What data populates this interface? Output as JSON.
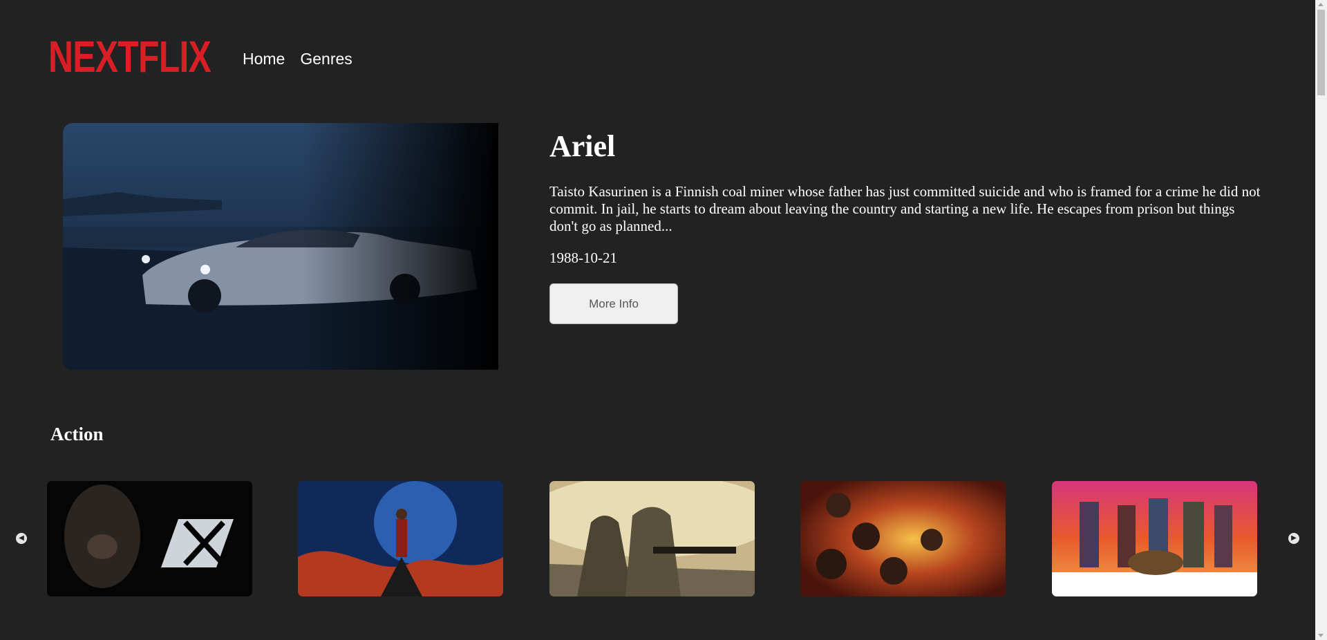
{
  "header": {
    "logo": "NEXTFLIX",
    "nav": [
      {
        "label": "Home"
      },
      {
        "label": "Genres"
      }
    ]
  },
  "hero": {
    "title": "Ariel",
    "description": "Taisto Kasurinen is a Finnish coal miner whose father has just committed suicide and who is framed for a crime he did not commit. In jail, he starts to dream about leaving the country and starting a new life. He escapes from prison but things don't go as planned...",
    "date": "1988-10-21",
    "button_label": "More Info"
  },
  "row": {
    "title": "Action",
    "prev_icon": "chevron-left-icon",
    "next_icon": "chevron-right-icon"
  },
  "colors": {
    "background": "#232223",
    "logo": "#d81f26",
    "text": "#ffffff",
    "button_bg": "#efefef"
  }
}
